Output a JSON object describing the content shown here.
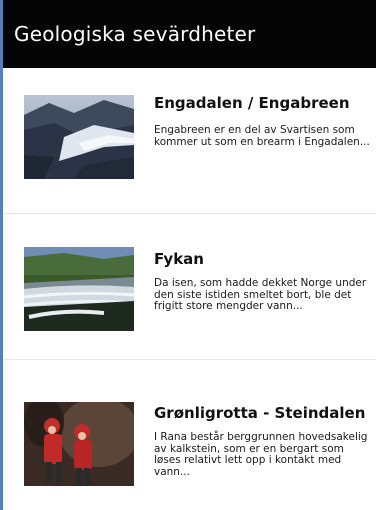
{
  "header": {
    "title": "Geologiska sevärdheter"
  },
  "items": [
    {
      "title": "Engadalen / Engabreen",
      "description": "Engabreen er en del av Svartisen som kommer ut som en brearm i Engadalen...",
      "image_icon": "glacier-photo"
    },
    {
      "title": "Fykan",
      "description": "Da isen, som hadde dekket Norge under den siste istiden smeltet bort, ble det frigitt store mengder vann...",
      "image_icon": "waterfall-photo"
    },
    {
      "title": "Grønligrotta - Steindalen",
      "description": "I Rana består berggrunnen hovedsakelig av kalkstein, som er en bergart som løses relativt lett opp i kontakt med vann...",
      "image_icon": "cave-photo"
    }
  ]
}
